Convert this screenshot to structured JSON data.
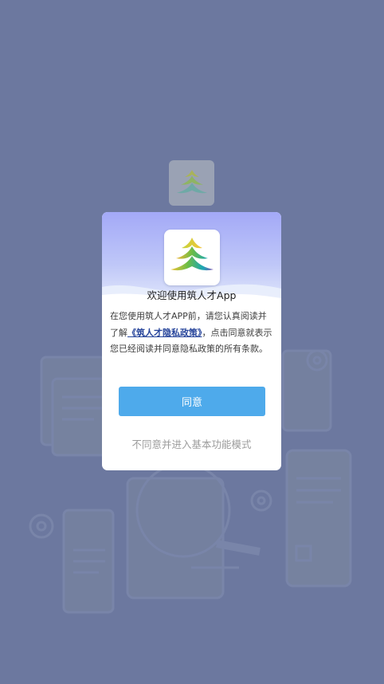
{
  "dialog": {
    "title": "欢迎使用筑人才App",
    "body_prefix": "在您使用筑人才APP前，请您认真阅读并了解",
    "policy_link": "《筑人才隐私政策》",
    "body_suffix": "，点击同意就表示您已经阅读并同意隐私政策的所有条款。",
    "agree_label": "同意",
    "disagree_label": "不同意并进入基本功能模式"
  },
  "colors": {
    "backdrop": "#6c789f",
    "agree_button": "#4eaaeb",
    "link": "#27459b",
    "logo_yellow": "#f2c43a",
    "logo_green": "#6cbd45",
    "logo_teal": "#19a7b5",
    "logo_purple": "#8a56b7"
  },
  "icons": {
    "logo": "zhurencai-tree-logo-icon"
  }
}
